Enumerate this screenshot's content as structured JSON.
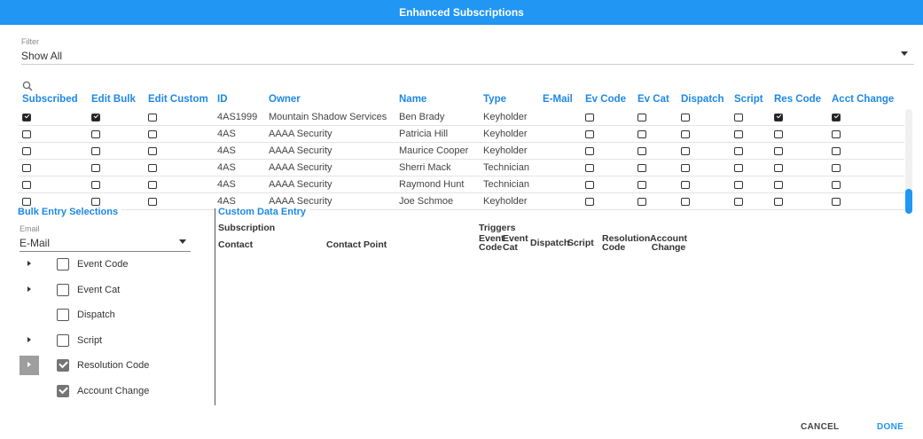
{
  "dialog": {
    "title": "Enhanced Subscriptions"
  },
  "filter": {
    "label": "Filter",
    "value": "Show All"
  },
  "search": {
    "icon": "search-icon"
  },
  "table": {
    "headers": [
      "Subscribed",
      "Edit Bulk",
      "Edit Custom",
      "ID",
      "Owner",
      "Name",
      "Type",
      "E-Mail",
      "Ev Code",
      "Ev Cat",
      "Dispatch",
      "Script",
      "Res Code",
      "Acct Change"
    ],
    "rows": [
      {
        "subscribed": true,
        "edit_bulk": true,
        "edit_custom": false,
        "id": "4AS1999",
        "owner": "Mountain Shadow Services",
        "name": "Ben Brady",
        "type": "Keyholder",
        "ev_code": false,
        "ev_cat": false,
        "dispatch": false,
        "script": false,
        "res_code": true,
        "acct_change": true
      },
      {
        "subscribed": false,
        "edit_bulk": false,
        "edit_custom": false,
        "id": "4AS",
        "owner": "AAAA Security",
        "name": "Patricia Hill",
        "type": "Keyholder",
        "ev_code": false,
        "ev_cat": false,
        "dispatch": false,
        "script": false,
        "res_code": false,
        "acct_change": false
      },
      {
        "subscribed": false,
        "edit_bulk": false,
        "edit_custom": false,
        "id": "4AS",
        "owner": "AAAA Security",
        "name": "Maurice Cooper",
        "type": "Keyholder",
        "ev_code": false,
        "ev_cat": false,
        "dispatch": false,
        "script": false,
        "res_code": false,
        "acct_change": false
      },
      {
        "subscribed": false,
        "edit_bulk": false,
        "edit_custom": false,
        "id": "4AS",
        "owner": "AAAA Security",
        "name": "Sherri Mack",
        "type": "Technician",
        "ev_code": false,
        "ev_cat": false,
        "dispatch": false,
        "script": false,
        "res_code": false,
        "acct_change": false
      },
      {
        "subscribed": false,
        "edit_bulk": false,
        "edit_custom": false,
        "id": "4AS",
        "owner": "AAAA Security",
        "name": "Raymond Hunt",
        "type": "Technician",
        "ev_code": false,
        "ev_cat": false,
        "dispatch": false,
        "script": false,
        "res_code": false,
        "acct_change": false
      },
      {
        "subscribed": false,
        "edit_bulk": false,
        "edit_custom": false,
        "id": "4AS",
        "owner": "AAAA Security",
        "name": "Joe Schmoe",
        "type": "Keyholder",
        "ev_code": false,
        "ev_cat": false,
        "dispatch": false,
        "script": false,
        "res_code": false,
        "acct_change": false
      }
    ]
  },
  "bulk": {
    "title": "Bulk Entry Selections",
    "email_label": "Email",
    "email_value": "E-Mail",
    "items": [
      {
        "label": "Event Code",
        "checked": false,
        "expandable": true,
        "selected": false
      },
      {
        "label": "Event Cat",
        "checked": false,
        "expandable": true,
        "selected": false
      },
      {
        "label": "Dispatch",
        "checked": false,
        "expandable": false,
        "selected": false
      },
      {
        "label": "Script",
        "checked": false,
        "expandable": true,
        "selected": false
      },
      {
        "label": "Resolution Code",
        "checked": true,
        "expandable": true,
        "selected": true
      },
      {
        "label": "Account Change",
        "checked": true,
        "expandable": false,
        "selected": false
      }
    ]
  },
  "custom": {
    "title": "Custom Data Entry",
    "subscription": "Subscription",
    "contact": "Contact",
    "contact_point": "Contact Point",
    "triggers": "Triggers",
    "event_code": "Event Code",
    "event_cat": "Event Cat",
    "dispatch": "Dispatch",
    "script": "Script",
    "resolution_code": "Resolution Code",
    "account_change": "Account Change"
  },
  "actions": {
    "cancel": "CANCEL",
    "done": "DONE"
  },
  "colors": {
    "accent": "#2196f3",
    "header_text": "#1e88e5"
  }
}
